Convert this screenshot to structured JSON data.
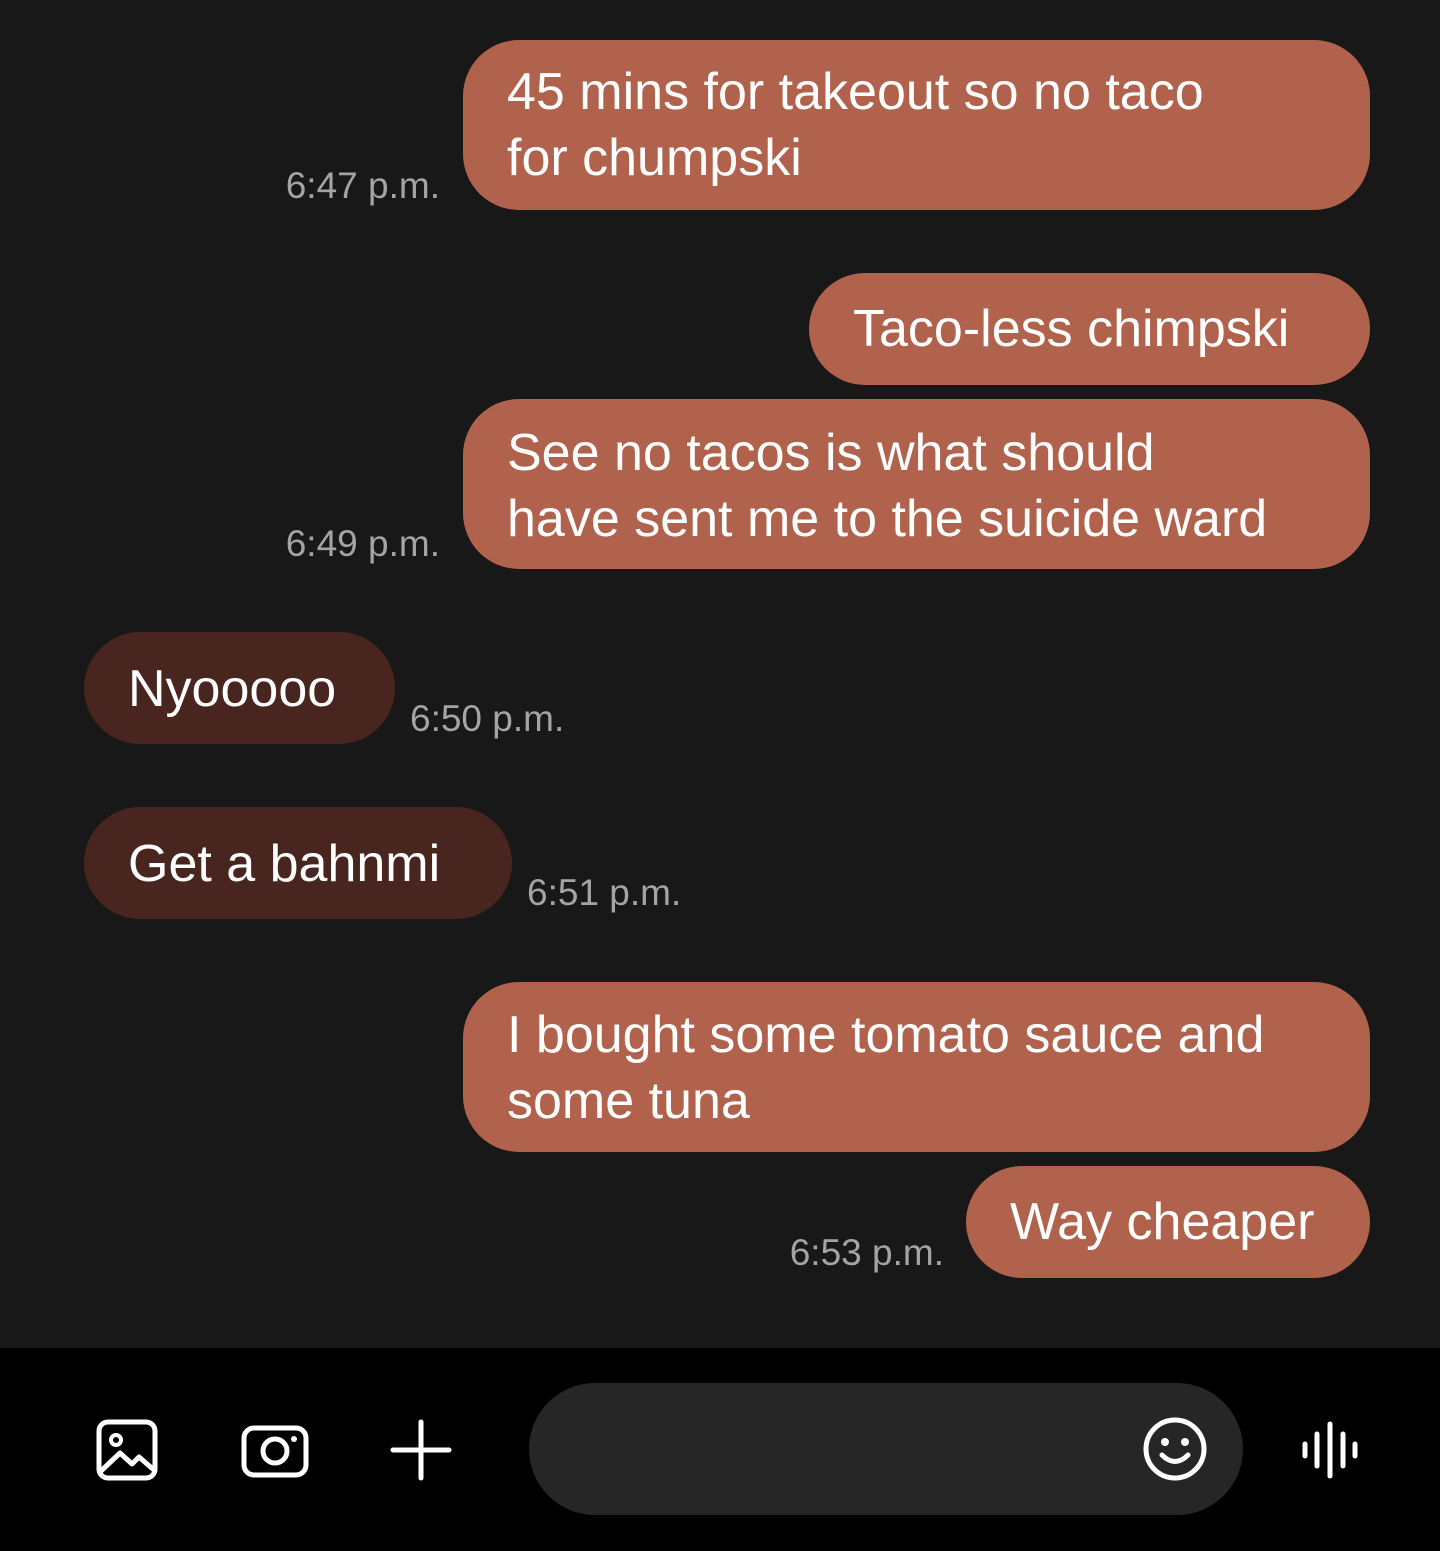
{
  "messages": [
    {
      "direction": "sent",
      "lines": [
        "45 mins for takeout so no taco",
        "for chumpski"
      ],
      "time": "6:47 p.m."
    },
    {
      "direction": "sent",
      "lines": [
        "Taco-less chimpski"
      ],
      "time": ""
    },
    {
      "direction": "sent",
      "lines": [
        "See no tacos is what should",
        "have sent me to the suicide ward"
      ],
      "time": "6:49 p.m."
    },
    {
      "direction": "received",
      "lines": [
        "Nyooooo"
      ],
      "time": "6:50 p.m."
    },
    {
      "direction": "received",
      "lines": [
        "Get a bahnmi"
      ],
      "time": "6:51 p.m."
    },
    {
      "direction": "sent",
      "lines": [
        "I bought some tomato sauce and",
        "some tuna"
      ],
      "time": ""
    },
    {
      "direction": "sent",
      "lines": [
        "Way cheaper"
      ],
      "time": "6:53 p.m."
    }
  ],
  "composer": {
    "placeholder": "",
    "value": ""
  },
  "icons": {
    "gallery": "image-gallery-icon",
    "camera": "camera-icon",
    "attach": "plus-icon",
    "emoji": "emoji-smile-icon",
    "voice": "voice-waveform-icon"
  },
  "colors": {
    "background": "#181818",
    "sent_bubble": "#b0624c",
    "received_bubble": "#48261f",
    "timestamp": "#a4a4a4",
    "bottom_bar": "#000000",
    "input_pill": "#262626"
  }
}
